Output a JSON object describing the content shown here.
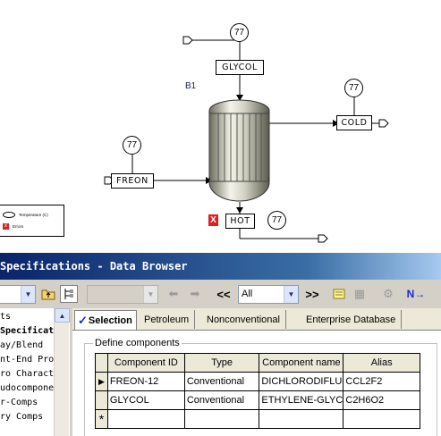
{
  "flowsheet": {
    "block_id": "B1",
    "streams": {
      "glycol": "GLYCOL",
      "cold": "COLD",
      "freon": "FREON",
      "hot": "HOT"
    },
    "temperatures": {
      "glycol": "77",
      "cold": "77",
      "freon": "77",
      "hot": "77"
    },
    "legend": {
      "temperature": "Temperature (C)",
      "errors": "Errors"
    },
    "error_marker": "X"
  },
  "window": {
    "title": "Specifications - Data Browser"
  },
  "toolbar": {
    "nav_back": "<<",
    "nav_forward": ">>",
    "filter_value": "All",
    "next_label": "N→"
  },
  "tree": {
    "items": [
      "ts",
      "Specificatio",
      "ay/Blend",
      "nt-End Proj",
      "ro Charact",
      "udocomponer",
      "r-Comps",
      "ry Comps"
    ]
  },
  "tabs": [
    {
      "label": "Selection",
      "active": true
    },
    {
      "label": "Petroleum",
      "active": false
    },
    {
      "label": "Nonconventional",
      "active": false
    },
    {
      "label": "Enterprise Database",
      "active": false
    }
  ],
  "components": {
    "group_label": "Define components",
    "columns": [
      "Component ID",
      "Type",
      "Component name",
      "Alias"
    ],
    "rows": [
      {
        "id": "FREON-12",
        "type": "Conventional",
        "name": "DICHLORODIFLUOROMETHANE",
        "alias": "CCL2F2"
      },
      {
        "id": "GLYCOL",
        "type": "Conventional",
        "name": "ETHYLENE-GLYCOL",
        "alias": "C2H6O2"
      }
    ],
    "new_row_marker": "*"
  },
  "colors": {
    "title_bar": "#0a246a",
    "error_red": "#e02020"
  }
}
